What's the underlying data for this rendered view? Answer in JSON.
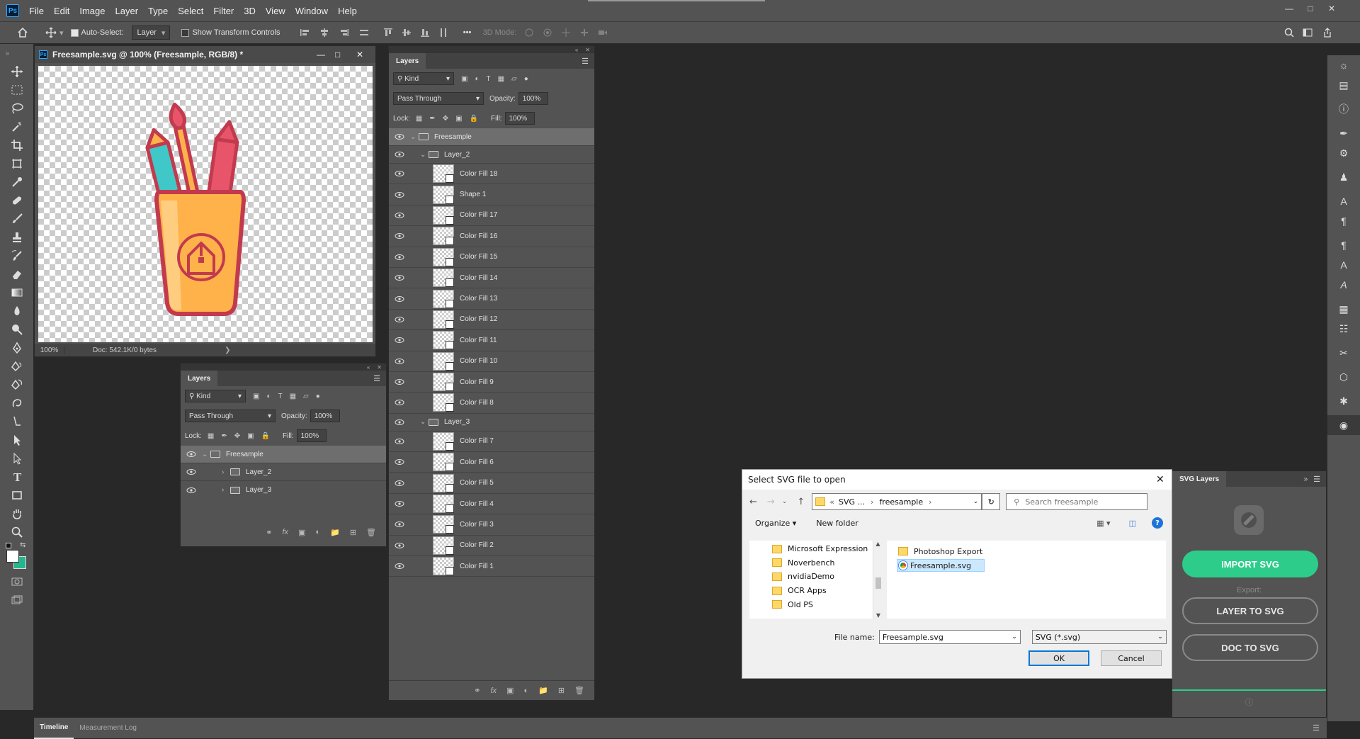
{
  "app": {
    "menu": [
      "File",
      "Edit",
      "Image",
      "Layer",
      "Type",
      "Select",
      "Filter",
      "3D",
      "View",
      "Window",
      "Help"
    ],
    "logo": "Ps"
  },
  "options": {
    "auto_select_label": "Auto-Select:",
    "auto_select_target": "Layer",
    "show_transform_label": "Show Transform Controls",
    "mode_3d_label": "3D Mode:"
  },
  "document": {
    "title": "Freesample.svg @ 100% (Freesample, RGB/8) *",
    "zoom": "100%",
    "doc_info": "Doc: 542.1K/0 bytes"
  },
  "layers_small": {
    "tab": "Layers",
    "kind": "Kind",
    "blend": "Pass Through",
    "opacity_label": "Opacity:",
    "opacity": "100%",
    "lock_label": "Lock:",
    "fill_label": "Fill:",
    "fill": "100%",
    "rows": [
      {
        "name": "Freesample"
      },
      {
        "name": "Layer_2"
      },
      {
        "name": "Layer_3"
      }
    ]
  },
  "layers_big": {
    "tab": "Layers",
    "kind": "Kind",
    "blend": "Pass Through",
    "opacity_label": "Opacity:",
    "opacity": "100%",
    "lock_label": "Lock:",
    "fill_label": "Fill:",
    "fill": "100%",
    "root": "Freesample",
    "group1": "Layer_2",
    "group1_items": [
      "Color Fill 18",
      "Shape 1",
      "Color Fill 17",
      "Color Fill 16",
      "Color Fill 15",
      "Color Fill 14",
      "Color Fill 13",
      "Color Fill 12",
      "Color Fill 11",
      "Color Fill 10",
      "Color Fill 9",
      "Color Fill 8"
    ],
    "group2": "Layer_3",
    "group2_items": [
      "Color Fill 7",
      "Color Fill 6",
      "Color Fill 5",
      "Color Fill 4",
      "Color Fill 3",
      "Color Fill 2",
      "Color Fill 1"
    ]
  },
  "dialog": {
    "title": "Select SVG file to open",
    "breadcrumb": [
      "SVG ...",
      "freesample"
    ],
    "search_placeholder": "Search freesample",
    "organize": "Organize",
    "new_folder": "New folder",
    "tree": [
      "Microsoft Expression",
      "Noverbench",
      "nvidiaDemo",
      "OCR Apps",
      "Old PS"
    ],
    "files": [
      {
        "name": "Photoshop Export",
        "type": "folder"
      },
      {
        "name": "Freesample.svg",
        "type": "svg"
      }
    ],
    "filename_label": "File name:",
    "filename": "Freesample.svg",
    "filetype": "SVG (*.svg)",
    "ok": "OK",
    "cancel": "Cancel"
  },
  "svg_panel": {
    "tab": "SVG Layers",
    "import_btn": "IMPORT SVG",
    "export_label": "Export:",
    "layer_btn": "LAYER TO SVG",
    "doc_btn": "DOC TO SVG",
    "import_color": "#2ecc8a"
  },
  "timeline": {
    "tabs": [
      "Timeline",
      "Measurement Log"
    ]
  },
  "colors": {
    "pencil_red": "#e8556b",
    "pencil_teal": "#40c8c8",
    "cup_orange": "#ffb24a",
    "outline": "#c23a4e"
  }
}
